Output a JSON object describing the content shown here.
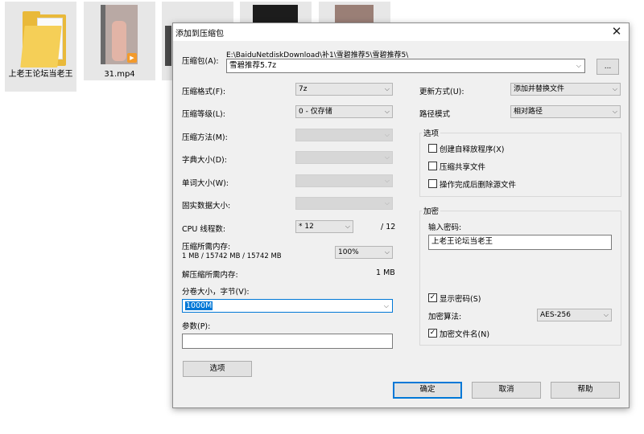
{
  "desktop": {
    "folder_label": "上老王论坛当老王",
    "video_label": "31.mp4"
  },
  "dialog": {
    "title": "添加到压缩包",
    "archive": {
      "label": "压缩包(A):",
      "path": "E:\\BaiduNetdiskDownload\\补1\\雪碧推荐5\\雪碧推荐5\\",
      "name": "雪碧推荐5.7z",
      "browse": "..."
    },
    "left": {
      "format_label": "压缩格式(F):",
      "format_value": "7z",
      "level_label": "压缩等级(L):",
      "level_value": "0 - 仅存储",
      "method_label": "压缩方法(M):",
      "dict_label": "字典大小(D):",
      "word_label": "单词大小(W):",
      "solid_label": "固实数据大小:",
      "cpu_label": "CPU 线程数:",
      "cpu_value": "* 12",
      "cpu_total": "/ 12",
      "mem_comp_label": "压缩所需内存:",
      "mem_comp_value": "1 MB / 15742 MB / 15742 MB",
      "mem_pct": "100%",
      "mem_decomp_label": "解压缩所需内存:",
      "mem_decomp_value": "1 MB",
      "volume_label": "分卷大小，字节(V):",
      "volume_value": "1000M",
      "params_label": "参数(P):",
      "params_value": "",
      "options_button": "选项"
    },
    "right": {
      "update_label": "更新方式(U):",
      "update_value": "添加并替换文件",
      "pathmode_label": "路径模式",
      "pathmode_value": "相对路径",
      "options_group": "选项",
      "opt_sfx": "创建自释放程序(X)",
      "opt_shared": "压缩共享文件",
      "opt_delete": "操作完成后删除源文件",
      "encrypt_group": "加密",
      "pwd_label": "输入密码:",
      "pwd_value": "上老王论坛当老王",
      "show_pwd": "显示密码(S)",
      "show_pwd_checked": true,
      "enc_method_label": "加密算法:",
      "enc_method_value": "AES-256",
      "enc_names": "加密文件名(N)",
      "enc_names_checked": true
    },
    "buttons": {
      "ok": "确定",
      "cancel": "取消",
      "help": "帮助"
    }
  }
}
